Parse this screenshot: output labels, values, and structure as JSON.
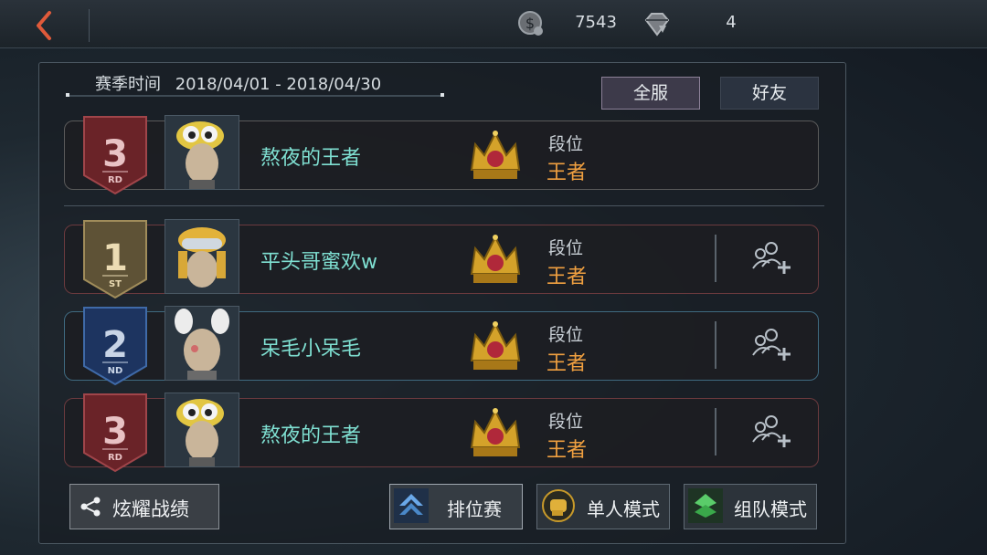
{
  "topbar": {
    "coins": "7543",
    "diamonds": "4"
  },
  "season": {
    "label": "赛季时间",
    "range": "2018/04/01 - 2018/04/30"
  },
  "tabs": {
    "all": "全服",
    "friends": "好友"
  },
  "self_row": {
    "rank_number": "3",
    "rank_suffix": "RD",
    "name": "熬夜的王者",
    "tier_label": "段位",
    "tier_value": "王者"
  },
  "rows": [
    {
      "rank_number": "1",
      "rank_suffix": "ST",
      "name": "平头哥蜜欢w",
      "tier_label": "段位",
      "tier_value": "王者"
    },
    {
      "rank_number": "2",
      "rank_suffix": "ND",
      "name": "呆毛小呆毛",
      "tier_label": "段位",
      "tier_value": "王者"
    },
    {
      "rank_number": "3",
      "rank_suffix": "RD",
      "name": "熬夜的王者",
      "tier_label": "段位",
      "tier_value": "王者"
    }
  ],
  "buttons": {
    "share": "炫耀战绩",
    "ranked": "排位赛",
    "solo": "单人模式",
    "team": "组队模式"
  },
  "colors": {
    "name": "#7fe0d2",
    "tier": "#f0a040",
    "badge_red": "#7a2a30",
    "badge_gold": "#6a5a3a",
    "badge_blue": "#1f3a6a"
  }
}
